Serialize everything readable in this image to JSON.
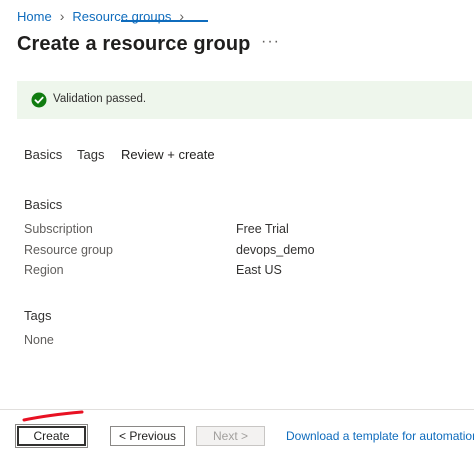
{
  "breadcrumb": {
    "items": [
      "Home",
      "Resource groups"
    ]
  },
  "page": {
    "title": "Create a resource group",
    "more_label": "···"
  },
  "banner": {
    "text": "Validation passed.",
    "status_color": "#107c10",
    "icon": "check-circle-icon"
  },
  "tabs": {
    "items": [
      "Basics",
      "Tags",
      "Review + create"
    ],
    "active": "Review + create"
  },
  "basics": {
    "heading": "Basics",
    "rows": [
      {
        "label": "Subscription",
        "value": "Free Trial"
      },
      {
        "label": "Resource group",
        "value": "devops_demo"
      },
      {
        "label": "Region",
        "value": "East US"
      }
    ]
  },
  "tags": {
    "heading": "Tags",
    "value": "None"
  },
  "footer": {
    "create_label": "Create",
    "previous_label": "< Previous",
    "next_label": "Next >",
    "download_label": "Download a template for automation"
  },
  "colors": {
    "accent": "#0f6cbd",
    "annotation": "#e81123"
  }
}
